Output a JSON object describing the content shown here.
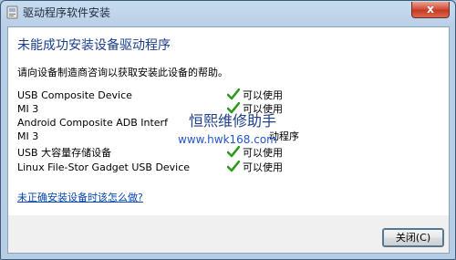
{
  "window": {
    "title": "驱动程序软件安装",
    "close_label": "x"
  },
  "main": {
    "heading": "未能成功安装设备驱动程序",
    "description": "请向设备制造商咨询以获取安装此设备的帮助。",
    "devices": [
      {
        "name": "USB Composite Device",
        "status": "可以使用",
        "ok": true
      },
      {
        "name": "MI 3",
        "status": "可以使用",
        "ok": true
      },
      {
        "name": "Android Composite ADB Interf",
        "status": "",
        "ok": false
      },
      {
        "name": "MI 3",
        "status": "动程序",
        "ok": false
      },
      {
        "name": "USB 大容量存储设备",
        "status": "可以使用",
        "ok": true
      },
      {
        "name": "Linux File-Stor Gadget USB Device",
        "status": "可以使用",
        "ok": true
      }
    ],
    "help_link": "未正确安装设备时该怎么做?"
  },
  "footer": {
    "close_button": "关闭(C)"
  },
  "watermark": {
    "line1": "恒熙维修助手",
    "line2": "www.hwk168.com"
  },
  "colors": {
    "heading": "#1a3e8c",
    "link": "#0645ad",
    "check": "#2e9b1e"
  }
}
